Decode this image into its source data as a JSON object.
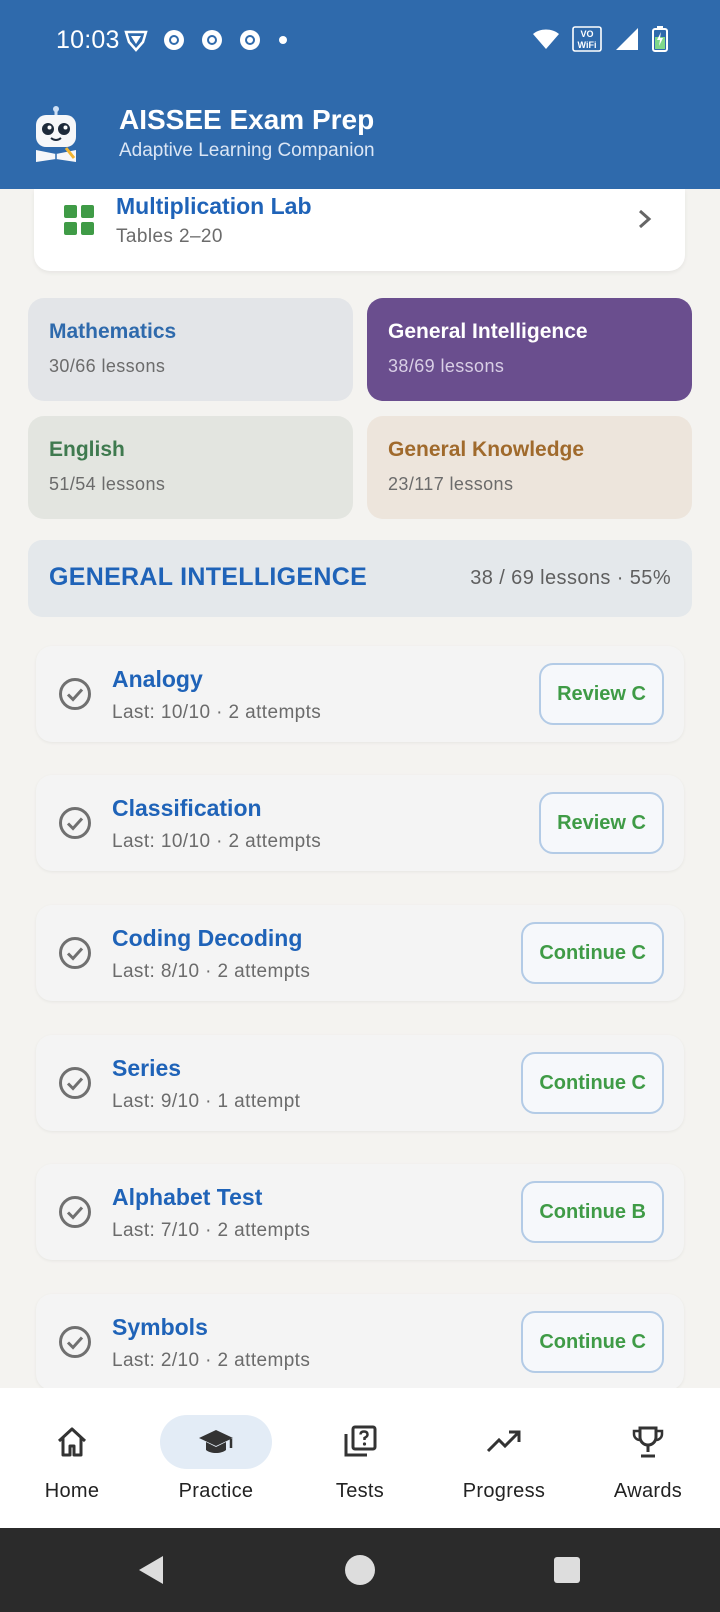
{
  "status": {
    "time": "10:03",
    "left_icons": [
      "vpn-shield-icon",
      "chrome-icon",
      "chrome-icon",
      "chrome-icon",
      "dot-icon"
    ],
    "right_icons": [
      "wifi-icon",
      "vowifi-icon",
      "signal-icon",
      "battery-charging-icon"
    ],
    "vowifi_top": "VO",
    "vowifi_bottom": "WiFi"
  },
  "header": {
    "title": "AISSEE Exam Prep",
    "subtitle": "Adaptive Learning Companion",
    "logo_icon": "robot-mascot-icon",
    "color": "#2f6aac"
  },
  "lab": {
    "title": "Multiplication Lab",
    "subtitle": "Tables 2–20",
    "icon": "grid-apps-icon"
  },
  "subjects": [
    {
      "name": "Mathematics",
      "count": "30/66 lessons",
      "color": "#2f6aac"
    },
    {
      "name": "General Intelligence",
      "count": "38/69 lessons",
      "color": "#6a4e8e",
      "selected": true
    },
    {
      "name": "English",
      "count": "51/54 lessons",
      "color": "#3f7a4f"
    },
    {
      "name": "General Knowledge",
      "count": "23/117 lessons",
      "color": "#a06a2c"
    }
  ],
  "section": {
    "title": "GENERAL INTELLIGENCE",
    "progress": "38 / 69 lessons · 55%"
  },
  "lessons": [
    {
      "title": "Analogy",
      "meta": "Last: 10/10 · 2 attempts",
      "button": "Review C"
    },
    {
      "title": "Classification",
      "meta": "Last: 10/10 · 2 attempts",
      "button": "Review C"
    },
    {
      "title": "Coding Decoding",
      "meta": "Last: 8/10 · 2 attempts",
      "button": "Continue C"
    },
    {
      "title": "Series",
      "meta": "Last: 9/10 · 1 attempt",
      "button": "Continue C"
    },
    {
      "title": "Alphabet Test",
      "meta": "Last: 7/10 · 2 attempts",
      "button": "Continue B"
    },
    {
      "title": "Symbols",
      "meta": "Last: 2/10 · 2 attempts",
      "button": "Continue C"
    }
  ],
  "nav": [
    {
      "label": "Home",
      "icon": "home-icon"
    },
    {
      "label": "Practice",
      "icon": "graduation-cap-icon",
      "active": true
    },
    {
      "label": "Tests",
      "icon": "quiz-icon"
    },
    {
      "label": "Progress",
      "icon": "trending-up-icon"
    },
    {
      "label": "Awards",
      "icon": "trophy-icon"
    }
  ],
  "system_nav": [
    "back-icon",
    "home-circle-icon",
    "recents-icon"
  ]
}
